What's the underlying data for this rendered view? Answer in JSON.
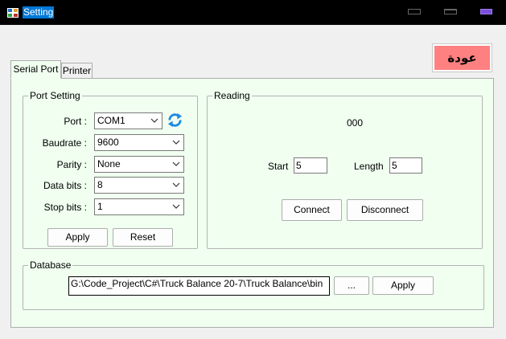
{
  "window": {
    "title": "Setting"
  },
  "back_button": {
    "label": "عودة",
    "color": "#ff8080"
  },
  "tabs": [
    {
      "label": "Serial Port",
      "active": true
    },
    {
      "label": "Printer",
      "active": false
    }
  ],
  "port_setting": {
    "legend": "Port Setting",
    "port": {
      "label": "Port :",
      "value": "COM1"
    },
    "baudrate": {
      "label": "Baudrate :",
      "value": "9600"
    },
    "parity": {
      "label": "Parity :",
      "value": "None"
    },
    "databits": {
      "label": "Data bits :",
      "value": "8"
    },
    "stopbits": {
      "label": "Stop bits :",
      "value": "1"
    },
    "apply_label": "Apply",
    "reset_label": "Reset",
    "refresh_icon": "refresh-icon"
  },
  "reading": {
    "legend": "Reading",
    "value": "000",
    "start_label": "Start",
    "start_value": "5",
    "length_label": "Length",
    "length_value": "5",
    "connect_label": "Connect",
    "disconnect_label": "Disconnect"
  },
  "database": {
    "legend": "Database",
    "path": "G:\\Code_Project\\C#\\Truck Balance 20-7\\Truck Balance\\bin",
    "browse_label": "...",
    "apply_label": "Apply"
  },
  "colors": {
    "panel_bg": "#f0fff0",
    "title_highlight": "#0078d7",
    "close_button": "#7b4fd9"
  }
}
